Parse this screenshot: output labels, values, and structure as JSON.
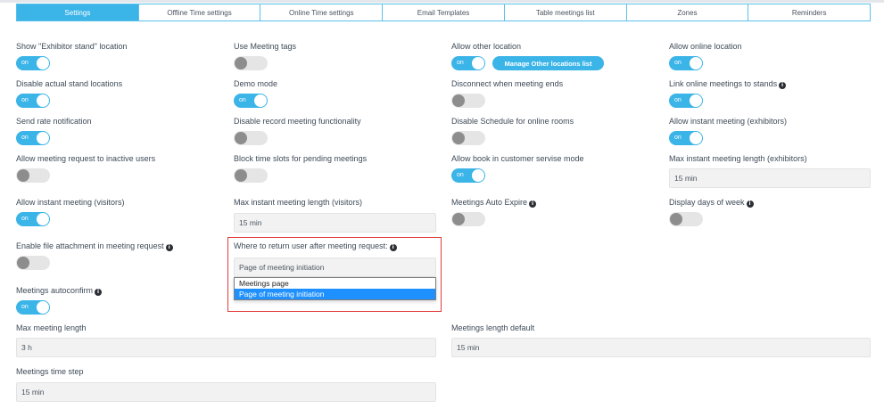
{
  "tabs": [
    {
      "label": "Settings",
      "active": true
    },
    {
      "label": "Offline Time settings",
      "active": false
    },
    {
      "label": "Online Time settings",
      "active": false
    },
    {
      "label": "Email Templates",
      "active": false
    },
    {
      "label": "Table meetings list",
      "active": false
    },
    {
      "label": "Zones",
      "active": false
    },
    {
      "label": "Reminders",
      "active": false
    }
  ],
  "toggle_on_text": "on",
  "settings": {
    "exhibitor_stand_location": "Show \"Exhibitor stand\" location",
    "use_meeting_tags": "Use Meeting tags",
    "allow_other_location": "Allow other location",
    "manage_other_locations_button": "Manage Other locations list",
    "allow_online_location": "Allow online location",
    "disable_actual_stand_locations": "Disable actual stand locations",
    "demo_mode": "Demo mode",
    "disconnect_when_meeting_ends": "Disconnect when meeting ends",
    "link_online_meetings_to_stands": "Link online meetings to stands",
    "send_rate_notification": "Send rate notification",
    "disable_record_meeting": "Disable record meeting functionality",
    "disable_schedule_online_rooms": "Disable Schedule for online rooms",
    "allow_instant_meeting_exhibitors": "Allow instant meeting (exhibitors)",
    "allow_request_inactive_users": "Allow meeting request to inactive users",
    "block_time_slots_pending": "Block time slots for pending meetings",
    "allow_book_customer_service": "Allow book in customer servise mode",
    "max_instant_length_exhibitors": "Max instant meeting length (exhibitors)",
    "max_instant_length_exhibitors_value": "15 min",
    "allow_instant_meeting_visitors": "Allow instant meeting (visitors)",
    "max_instant_length_visitors": "Max instant meeting length (visitors)",
    "max_instant_length_visitors_value": "15 min",
    "meetings_auto_expire": "Meetings Auto Expire",
    "display_days_of_week": "Display days of week",
    "enable_file_attachment": "Enable file attachment in meeting request",
    "where_to_return_user": "Where to return user after meeting request:",
    "where_to_return_value": "Page of meeting initiation",
    "return_options": [
      "Meetings page",
      "Page of meeting initiation"
    ],
    "meetings_autoconfirm": "Meetings autoconfirm",
    "max_meeting_length": "Max meeting length",
    "max_meeting_length_value": "3 h",
    "meetings_length_default": "Meetings length default",
    "meetings_length_default_value": "15 min",
    "meetings_time_step": "Meetings time step",
    "meetings_time_step_value": "15 min"
  },
  "colors": {
    "accent": "#3bb4e8",
    "highlight_border": "#e23a3a",
    "selected_option": "#1e90ff"
  }
}
